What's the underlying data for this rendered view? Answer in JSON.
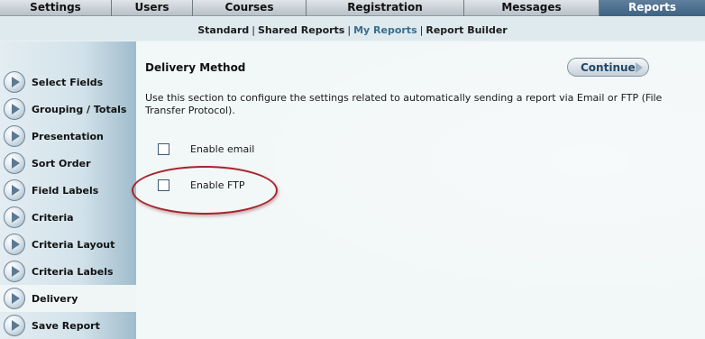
{
  "top_nav": {
    "tabs": [
      {
        "label": "Settings",
        "active": false
      },
      {
        "label": "Users",
        "active": false
      },
      {
        "label": "Courses",
        "active": false
      },
      {
        "label": "Registration",
        "active": false
      },
      {
        "label": "Messages",
        "active": false
      },
      {
        "label": "Reports",
        "active": true
      }
    ]
  },
  "sub_nav": {
    "links": [
      {
        "label": "Standard"
      },
      {
        "label": "Shared Reports"
      },
      {
        "label": "My Reports",
        "current": true
      },
      {
        "label": "Report Builder"
      }
    ]
  },
  "sidebar": {
    "items": [
      {
        "label": "Select Fields"
      },
      {
        "label": "Grouping / Totals"
      },
      {
        "label": "Presentation"
      },
      {
        "label": "Sort Order"
      },
      {
        "label": "Field Labels"
      },
      {
        "label": "Criteria"
      },
      {
        "label": "Criteria Layout"
      },
      {
        "label": "Criteria Labels"
      },
      {
        "label": "Delivery",
        "active": true
      },
      {
        "label": "Save Report"
      }
    ]
  },
  "main": {
    "title": "Delivery Method",
    "continue_label": "Continue",
    "description": "Use this section to configure the settings related to automatically sending a report via Email or FTP (File Transfer Protocol).",
    "options": [
      {
        "label": "Enable email",
        "checked": false
      },
      {
        "label": "Enable FTP",
        "checked": false
      }
    ]
  },
  "colors": {
    "active_tab": "#4a6d8c",
    "current_sublink": "#3a6d8d",
    "annotation_ellipse": "#a8232a"
  }
}
